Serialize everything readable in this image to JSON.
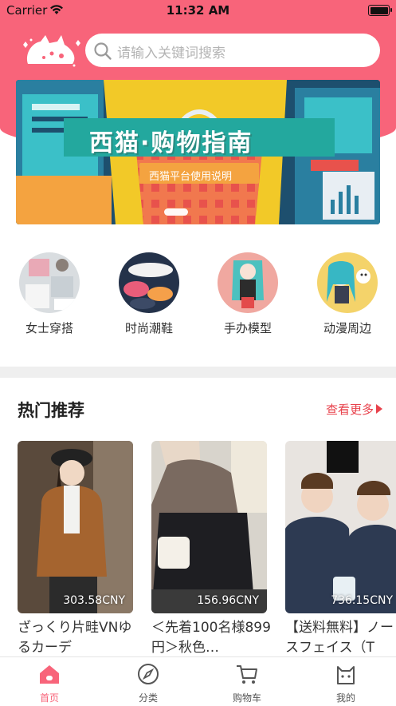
{
  "status_bar": {
    "carrier": "Carrier",
    "time": "11:32 AM"
  },
  "search": {
    "placeholder": "请输入关键词搜索"
  },
  "banner": {
    "title": "西猫·购物指南",
    "subtitle": "西猫平台使用说明"
  },
  "categories": [
    {
      "label": "女士穿搭"
    },
    {
      "label": "时尚潮鞋"
    },
    {
      "label": "手办模型"
    },
    {
      "label": "动漫周边"
    }
  ],
  "section": {
    "title": "热门推荐",
    "more_label": "查看更多"
  },
  "products": [
    {
      "price": "303.58CNY",
      "name": "ざっくり片畦VNゆるカーデ"
    },
    {
      "price": "156.96CNY",
      "name": "＜先着100名様899円＞秋色…"
    },
    {
      "price": "736.15CNY",
      "name": "【送料無料】ノースフェイス（T"
    }
  ],
  "tabs": [
    {
      "label": "首页",
      "active": true
    },
    {
      "label": "分类"
    },
    {
      "label": "购物车"
    },
    {
      "label": "我的"
    }
  ],
  "colors": {
    "brand": "#f8647a",
    "accent_red": "#e8424c"
  }
}
